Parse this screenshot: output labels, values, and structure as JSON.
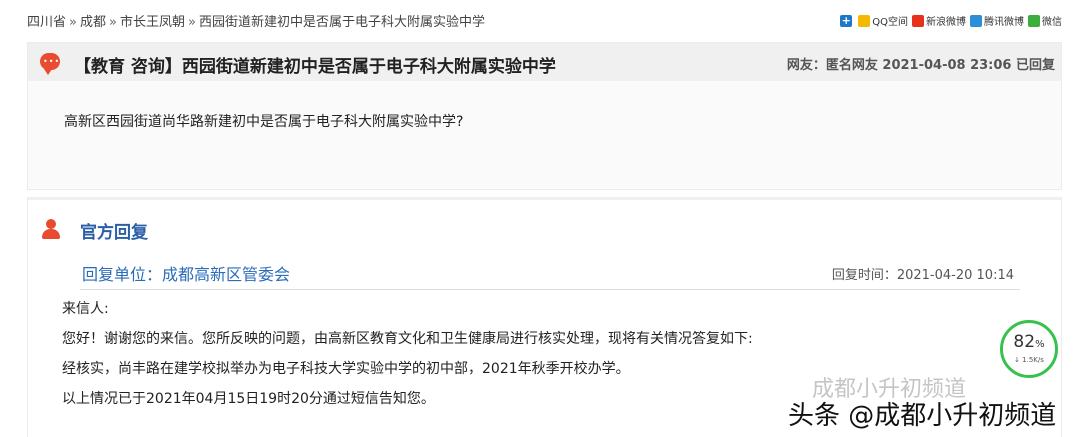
{
  "breadcrumb": [
    "四川省",
    "成都",
    "市长王凤朝",
    "西园街道新建初中是否属于电子科大附属实验中学"
  ],
  "breadcrumb_separator": "»",
  "share": {
    "qq": "QQ空间",
    "sina": "新浪微博",
    "tencent": "腾讯微博",
    "wechat": "微信"
  },
  "question": {
    "title": "【教育 咨询】西园街道新建初中是否属于电子科大附属实验中学",
    "meta": "网友：匿名网友  2021-04-08 23:06 已回复",
    "body": "高新区西园街道尚华路新建初中是否属于电子科大附属实验中学?"
  },
  "reply": {
    "title": "官方回复",
    "unit": "回复单位：成都高新区管委会",
    "time": "回复时间：2021-04-20 10:14",
    "lines": [
      "来信人:",
      "您好！谢谢您的来信。您所反映的问题，由高新区教育文化和卫生健康局进行核实处理，现将有关情况答复如下:",
      "经核实，尚丰路在建学校拟举办为电子科技大学实验中学的初中部，2021年秋季开校办学。",
      "以上情况已于2021年04月15日19时20分通过短信告知您。"
    ]
  },
  "speed_widget": {
    "percent": "82",
    "percent_unit": "%",
    "rate": "↓ 1.5K/s"
  },
  "watermarks": {
    "channel": "成都小升初频道",
    "toutiao": "头条 @成都小升初频道"
  },
  "colors": {
    "accent_red": "#e84b2f",
    "reply_blue": "#2a5fa8",
    "widget_green": "#38c14c"
  }
}
